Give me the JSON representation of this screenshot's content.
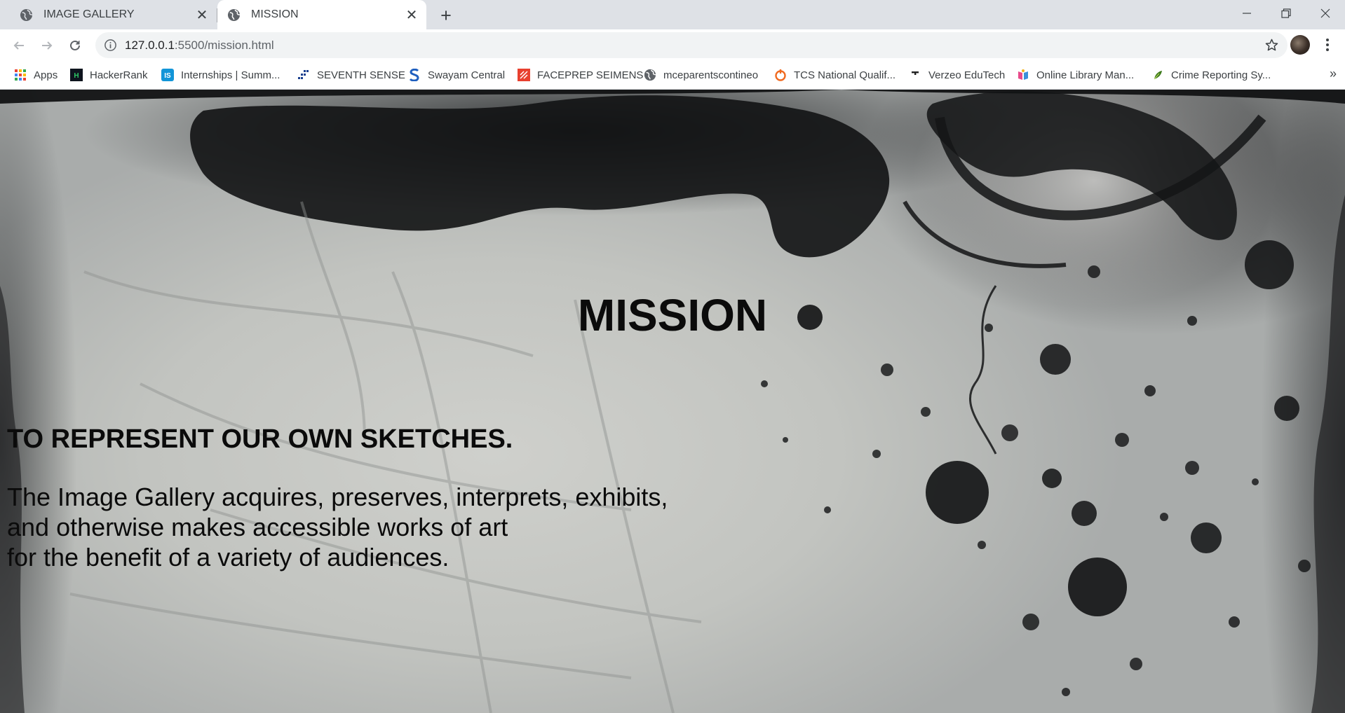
{
  "browser": {
    "tabs": [
      {
        "title": "IMAGE GALLERY",
        "active": false,
        "favicon": "globe-icon"
      },
      {
        "title": "MISSION",
        "active": true,
        "favicon": "globe-icon"
      }
    ],
    "url": {
      "host": "127.0.0.1",
      "path": ":5500/mission.html"
    },
    "bookmarks": [
      {
        "label": "Apps",
        "icon": "apps-grid-icon"
      },
      {
        "label": "HackerRank",
        "icon": "hackerrank-icon"
      },
      {
        "label": "Internships | Summ...",
        "icon": "internshala-icon"
      },
      {
        "label": "SEVENTH SENSE",
        "icon": "seventh-sense-icon"
      },
      {
        "label": "Swayam Central",
        "icon": "swayam-icon"
      },
      {
        "label": "FACEPREP SEIMENS",
        "icon": "faceprep-icon"
      },
      {
        "label": "mceparentscontineo",
        "icon": "globe-icon"
      },
      {
        "label": "TCS National Qualif...",
        "icon": "tcs-icon"
      },
      {
        "label": "Verzeo EduTech",
        "icon": "verzeo-icon"
      },
      {
        "label": "Online Library Man...",
        "icon": "library-icon"
      },
      {
        "label": "Crime Reporting Sy...",
        "icon": "leaf-icon"
      }
    ],
    "bookmarks_more": "»"
  },
  "page": {
    "title": "MISSION",
    "subtitle": "TO REPRESENT OUR OWN SKETCHES.",
    "body_lines": [
      "The Image Gallery acquires, preserves, interprets, exhibits,",
      "and otherwise makes accessible works of art",
      "for the benefit of a variety of audiences."
    ]
  },
  "colors": {
    "tab_strip": "#dee1e6",
    "toolbar": "#ffffff",
    "omnibox": "#f1f3f4",
    "text": "#0b0b0b"
  }
}
